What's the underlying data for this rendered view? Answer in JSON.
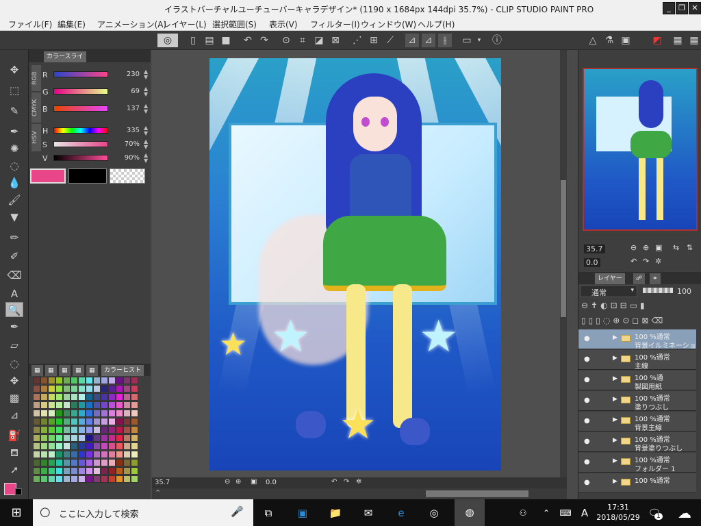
{
  "window": {
    "title": "イラストバーチャルユーチューバーキャラデザイン* (1190 x 1684px 144dpi 35.7%)  - CLIP STUDIO PAINT PRO",
    "minimize": "_",
    "maximize": "❐",
    "close": "✕"
  },
  "menu": [
    "ファイル(F)",
    "編集(E)",
    "アニメーション(A)",
    "レイヤー(L)",
    "選択範囲(S)",
    "表示(V)",
    "フィルター(I)",
    "ウィンドウ(W)",
    "ヘルプ(H)"
  ],
  "color_panel": {
    "tab": "カラースライ",
    "mode_tabs": [
      "RGB",
      "CMYK",
      "HSV"
    ],
    "rgb": [
      {
        "label": "R",
        "value": "230"
      },
      {
        "label": "G",
        "value": "69"
      },
      {
        "label": "B",
        "value": "137"
      }
    ],
    "hsv": [
      {
        "label": "H",
        "value": "335"
      },
      {
        "label": "S",
        "value": "70%"
      },
      {
        "label": "V",
        "value": "90%"
      }
    ],
    "main_color": "#e94589"
  },
  "history_tab": "カラーヒスト",
  "canvas_status": {
    "zoom": "35.7",
    "rotation": "0.0"
  },
  "navigator": {
    "zoom": "35.7",
    "rotation": "0.0"
  },
  "layer_panel": {
    "tab": "レイヤー",
    "blend_mode": "通常",
    "opacity": "100",
    "layers": [
      {
        "opacity": "100 %通常",
        "name": "背景イルミネーション",
        "selected": true
      },
      {
        "opacity": "100 %通常",
        "name": "主線",
        "selected": false
      },
      {
        "opacity": "100 %通",
        "name": "製図用紙",
        "selected": false
      },
      {
        "opacity": "100 %通常",
        "name": "塗りつぶし",
        "selected": false
      },
      {
        "opacity": "100 %通常",
        "name": "背景主線",
        "selected": false
      },
      {
        "opacity": "100 %通常",
        "name": "背景塗りつぶし",
        "selected": false
      },
      {
        "opacity": "100 %通常",
        "name": "フォルダー 1",
        "selected": false
      },
      {
        "opacity": "100 %通常",
        "name": "",
        "selected": false
      }
    ]
  },
  "taskbar": {
    "search_placeholder": "ここに入力して検索",
    "time": "17:31",
    "date": "2018/05/29",
    "ime": "A",
    "notification_count": "1"
  }
}
